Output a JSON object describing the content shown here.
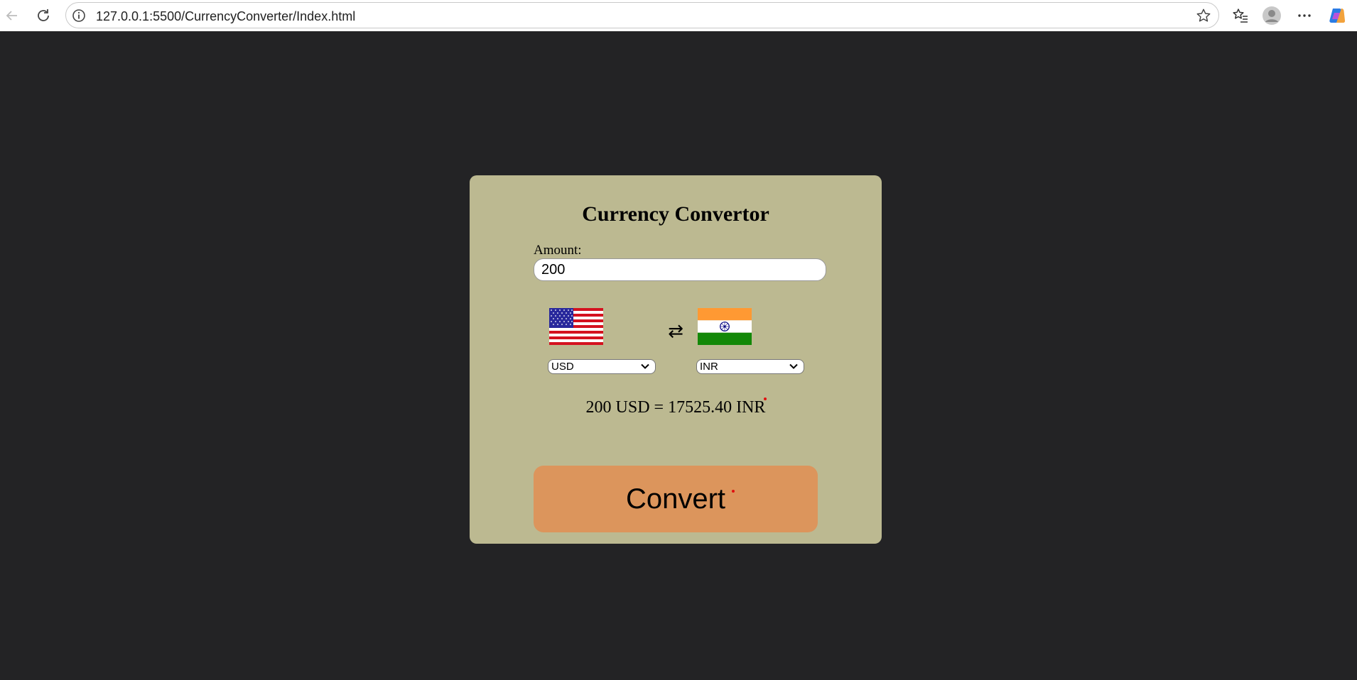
{
  "browser": {
    "url": "127.0.0.1:5500/CurrencyConverter/Index.html"
  },
  "converter": {
    "title": "Currency Convertor",
    "amount_label": "Amount:",
    "amount_value": "200",
    "from_currency": {
      "selected": "USD",
      "options": [
        "USD"
      ],
      "flag": "us-flag"
    },
    "to_currency": {
      "selected": "INR",
      "options": [
        "INR"
      ],
      "flag": "india-flag"
    },
    "swap_icon": "swap-arrows-icon",
    "result_text": "200 USD = 17525.40 INR",
    "convert_label": "Convert"
  },
  "colors": {
    "page_background": "#232325",
    "card_background": "#bcb991",
    "button_background": "#dc955c"
  }
}
